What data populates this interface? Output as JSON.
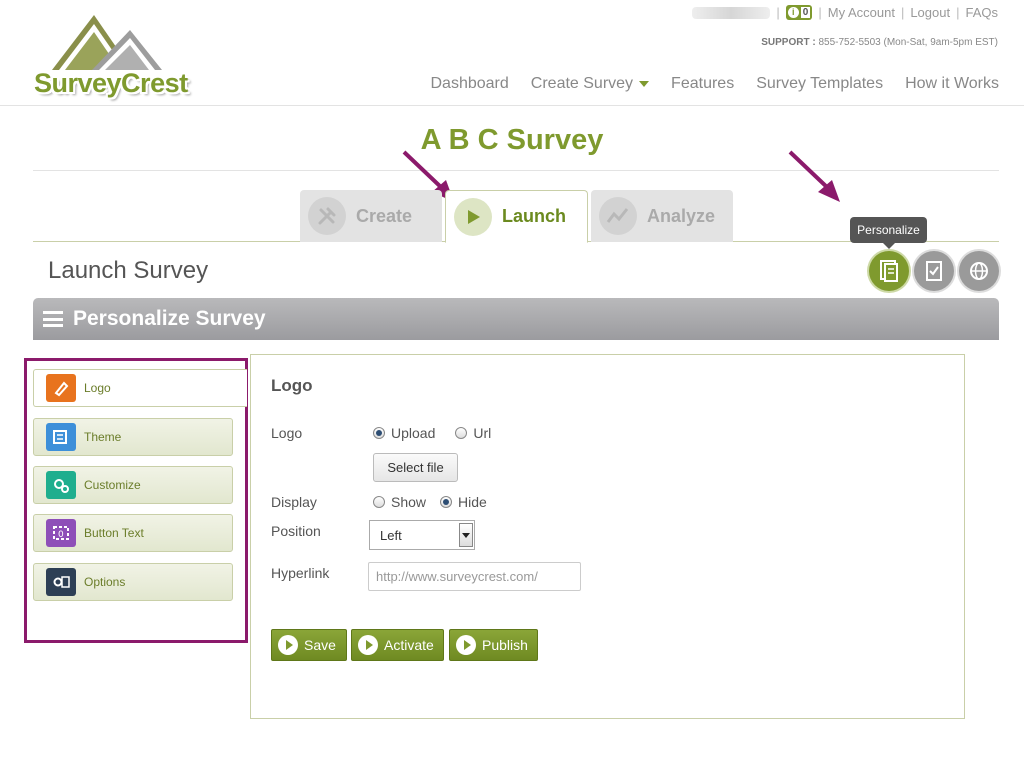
{
  "brand": {
    "name": "SurveyCrest"
  },
  "topbar": {
    "info_count": "0",
    "links": [
      "My Account",
      "Logout",
      "FAQs"
    ],
    "support_label": "SUPPORT :",
    "support_text": "855-752-5503 (Mon-Sat, 9am-5pm EST)"
  },
  "nav": {
    "items": [
      "Dashboard",
      "Create Survey",
      "Features",
      "Survey Templates",
      "How it Works"
    ]
  },
  "survey": {
    "title": "A B C Survey"
  },
  "tabs": [
    {
      "label": "Create",
      "icon": "tools-icon",
      "active": false
    },
    {
      "label": "Launch",
      "icon": "play-icon",
      "active": true
    },
    {
      "label": "Analyze",
      "icon": "chart-icon",
      "active": false
    }
  ],
  "launch": {
    "title": "Launch Survey",
    "tooltip": "Personalize",
    "actions": [
      "personalize-icon",
      "checklist-icon",
      "globe-icon"
    ]
  },
  "section": {
    "title": "Personalize Survey"
  },
  "side_menu": [
    {
      "label": "Logo",
      "icon": "logo-edit-icon",
      "color": "#e8731e"
    },
    {
      "label": "Theme",
      "icon": "theme-icon",
      "color": "#3d8fd9"
    },
    {
      "label": "Customize",
      "icon": "customize-icon",
      "color": "#1fae8e"
    },
    {
      "label": "Button Text",
      "icon": "button-text-icon",
      "color": "#8e4fb8"
    },
    {
      "label": "Options",
      "icon": "options-icon",
      "color": "#2d3f55"
    }
  ],
  "form": {
    "title": "Logo",
    "logo_label": "Logo",
    "logo_options": [
      "Upload",
      "Url"
    ],
    "logo_selected": "Upload",
    "select_file": "Select file",
    "display_label": "Display",
    "display_options": [
      "Show",
      "Hide"
    ],
    "display_selected": "Hide",
    "position_label": "Position",
    "position_value": "Left",
    "hyperlink_label": "Hyperlink",
    "hyperlink_placeholder": "http://www.surveycrest.com/"
  },
  "buttons": {
    "save": "Save",
    "activate": "Activate",
    "publish": "Publish"
  },
  "colors": {
    "brand_green": "#7f9a2e",
    "highlight": "#8b1a6b",
    "arrow": "#8b1a6b"
  }
}
